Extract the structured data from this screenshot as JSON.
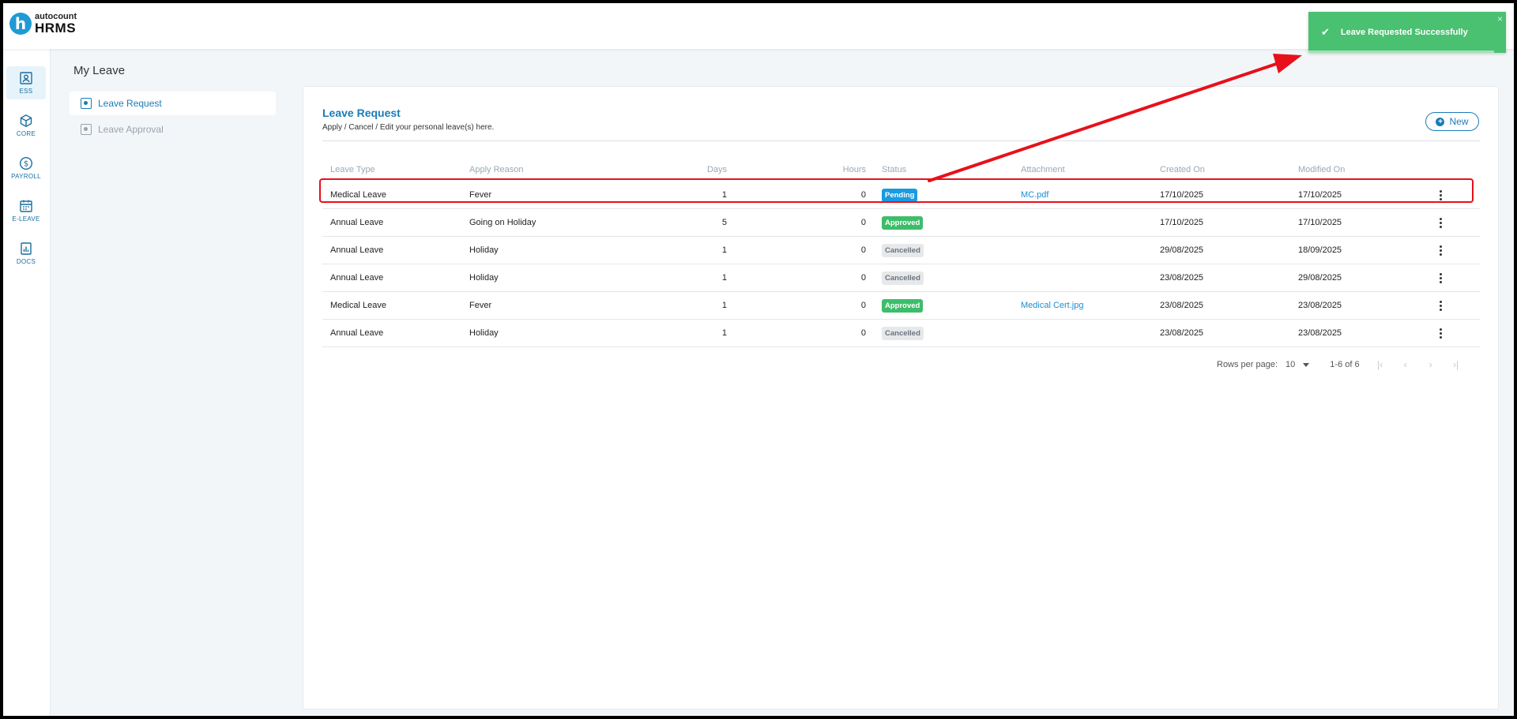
{
  "app": {
    "logo_small": "autocount",
    "logo_big": "HRMS",
    "logo_letter": "h"
  },
  "rail": [
    {
      "label": "ESS",
      "icon": "ess-icon"
    },
    {
      "label": "CORE",
      "icon": "cube-icon"
    },
    {
      "label": "PAYROLL",
      "icon": "dollar-icon"
    },
    {
      "label": "E-LEAVE",
      "icon": "calendar-icon"
    },
    {
      "label": "DOCS",
      "icon": "chart-doc-icon"
    }
  ],
  "page_title": "My Leave",
  "subnav": [
    {
      "label": "Leave Request"
    },
    {
      "label": "Leave Approval"
    }
  ],
  "card": {
    "title": "Leave Request",
    "subtitle": "Apply / Cancel / Edit your personal leave(s) here.",
    "new_label": "New"
  },
  "table": {
    "headers": {
      "type": "Leave Type",
      "reason": "Apply Reason",
      "days": "Days",
      "hours": "Hours",
      "status": "Status",
      "attachment": "Attachment",
      "created": "Created On",
      "modified": "Modified On"
    },
    "rows": [
      {
        "type": "Medical Leave",
        "reason": "Fever",
        "days": "1",
        "hours": "0",
        "status": "Pending",
        "attachment": "MC.pdf",
        "created": "17/10/2025",
        "modified": "17/10/2025"
      },
      {
        "type": "Annual Leave",
        "reason": "Going on Holiday",
        "days": "5",
        "hours": "0",
        "status": "Approved",
        "attachment": "",
        "created": "17/10/2025",
        "modified": "17/10/2025"
      },
      {
        "type": "Annual Leave",
        "reason": "Holiday",
        "days": "1",
        "hours": "0",
        "status": "Cancelled",
        "attachment": "",
        "created": "29/08/2025",
        "modified": "18/09/2025"
      },
      {
        "type": "Annual Leave",
        "reason": "Holiday",
        "days": "1",
        "hours": "0",
        "status": "Cancelled",
        "attachment": "",
        "created": "23/08/2025",
        "modified": "29/08/2025"
      },
      {
        "type": "Medical Leave",
        "reason": "Fever",
        "days": "1",
        "hours": "0",
        "status": "Approved",
        "attachment": "Medical Cert.jpg",
        "created": "23/08/2025",
        "modified": "23/08/2025"
      },
      {
        "type": "Annual Leave",
        "reason": "Holiday",
        "days": "1",
        "hours": "0",
        "status": "Cancelled",
        "attachment": "",
        "created": "23/08/2025",
        "modified": "23/08/2025"
      }
    ]
  },
  "pagination": {
    "rows_per_page_label": "Rows per page:",
    "rows_per_page_value": "10",
    "range": "1-6 of 6"
  },
  "toast": {
    "message": "Leave Requested Successfully",
    "close": "×",
    "check": "✔"
  },
  "colors": {
    "accent": "#1a7cb8",
    "pending": "#1a9ae0",
    "approved": "#3dbd6a",
    "toast": "#4ac071",
    "annotation": "#e8101a"
  }
}
